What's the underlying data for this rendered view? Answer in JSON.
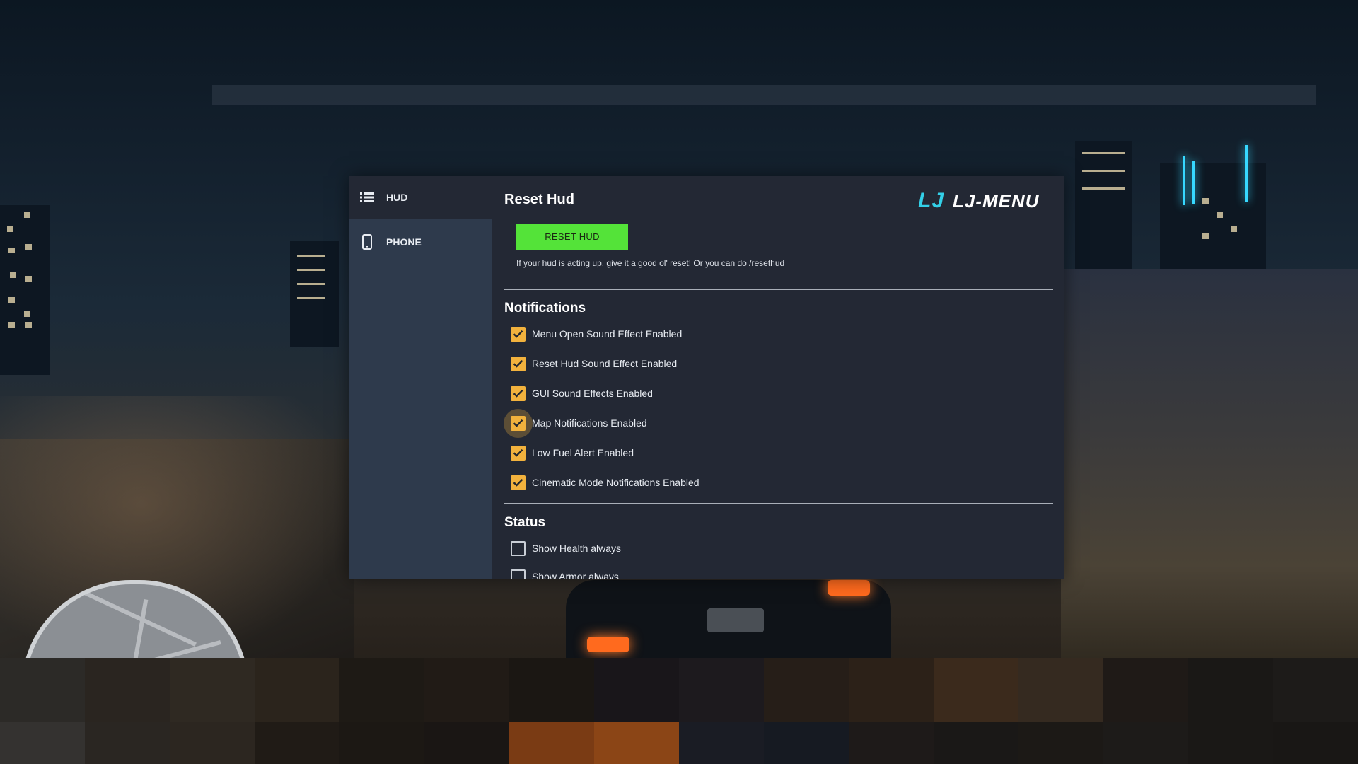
{
  "sidebar": {
    "items": [
      {
        "label": "HUD",
        "icon": "list-icon",
        "active": true
      },
      {
        "label": "PHONE",
        "icon": "phone-icon",
        "active": false
      }
    ]
  },
  "header": {
    "title": "Reset Hud",
    "logo_mark": "LJ",
    "logo_text": "LJ-MENU"
  },
  "reset": {
    "button_label": "RESET HUD",
    "hint": "If your hud is acting up, give it a good ol' reset! Or you can do /resethud"
  },
  "notifications": {
    "heading": "Notifications",
    "options": [
      {
        "label": "Menu Open Sound Effect Enabled",
        "checked": true
      },
      {
        "label": "Reset Hud Sound Effect Enabled",
        "checked": true
      },
      {
        "label": "GUI Sound Effects Enabled",
        "checked": true
      },
      {
        "label": "Map Notifications Enabled",
        "checked": true,
        "focused": true
      },
      {
        "label": "Low Fuel Alert Enabled",
        "checked": true
      },
      {
        "label": "Cinematic Mode Notifications Enabled",
        "checked": true
      }
    ]
  },
  "status": {
    "heading": "Status",
    "options": [
      {
        "label": "Show Health always",
        "checked": false
      },
      {
        "label": "Show Armor always",
        "checked": false
      }
    ]
  },
  "colors": {
    "accent_green": "#54e339",
    "checkbox_orange": "#f2b23d",
    "logo_cyan": "#33d0e8",
    "panel": "#232834",
    "sidebar": "#2e3a4c"
  }
}
